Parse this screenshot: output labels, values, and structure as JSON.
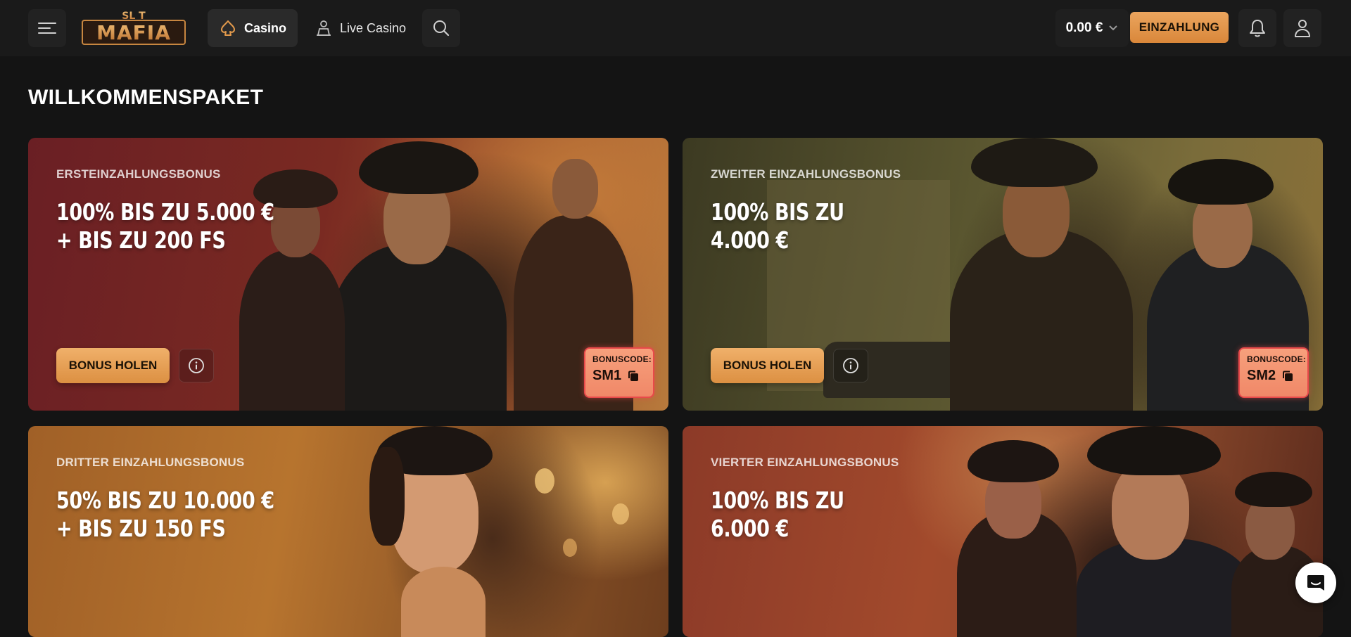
{
  "header": {
    "logo": {
      "top": "SL T",
      "main": "MAFIA"
    },
    "nav": [
      {
        "label": "Casino",
        "icon": "spade-icon",
        "active": true
      },
      {
        "label": "Live Casino",
        "icon": "dealer-icon",
        "active": false
      }
    ],
    "balance": "0.00 €",
    "deposit_label": "EINZAHLUNG"
  },
  "main": {
    "title": "WILLKOMMENSPAKET",
    "cards": [
      {
        "subtitle": "ERSTEINZAHLUNGSBONUS",
        "headline_1": "100% BIS ZU 5.000 €",
        "headline_2": "+ BIS ZU 200 FS",
        "button_label": "BONUS HOLEN",
        "code_label": "BONUSCODE:",
        "code": "SM1"
      },
      {
        "subtitle": "ZWEITER EINZAHLUNGSBONUS",
        "headline_1": "100% BIS ZU",
        "headline_2": "4.000 €",
        "button_label": "BONUS HOLEN",
        "code_label": "BONUSCODE:",
        "code": "SM2"
      },
      {
        "subtitle": "DRITTER EINZAHLUNGSBONUS",
        "headline_1": "50% BIS ZU 10.000 €",
        "headline_2": "+ BIS ZU 150 FS"
      },
      {
        "subtitle": "VIERTER EINZAHLUNGSBONUS",
        "headline_1": "100% BIS ZU",
        "headline_2": "6.000 €"
      }
    ]
  },
  "colors": {
    "accent": "#e39a4c",
    "background": "#141414",
    "code_border": "#e8494a"
  }
}
